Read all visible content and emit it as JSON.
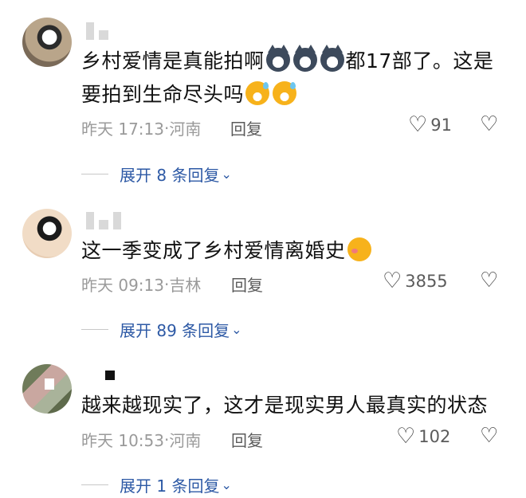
{
  "comments": [
    {
      "text_a": "乡村爱情是真能拍啊",
      "text_b": "都17部了。这是",
      "text_c": "要拍到生命尽头吗",
      "emoji_dog": "dog-emoji",
      "emoji_grin": "grin-sweat-emoji",
      "time": "昨天 17:13",
      "sep": "·",
      "location": "河南",
      "reply": "回复",
      "likes": "91",
      "expand": "展开 8 条回复"
    },
    {
      "text_a": "这一季变成了乡村爱情离婚史",
      "emoji_kiss": "kissing-emoji",
      "time": "昨天 09:13",
      "sep": "·",
      "location": "吉林",
      "reply": "回复",
      "likes": "3855",
      "expand": "展开 89 条回复"
    },
    {
      "text_a": "越来越现实了，这才是现实男人最真实的状态",
      "time": "昨天 10:53",
      "sep": "·",
      "location": "河南",
      "reply": "回复",
      "likes": "102",
      "expand": "展开 1 条回复"
    }
  ],
  "icons": {
    "heart": "♡",
    "broken_heart": "♡",
    "chevron": "⌄"
  },
  "colors": {
    "link": "#2d59a5",
    "muted": "#9a9a9a"
  }
}
